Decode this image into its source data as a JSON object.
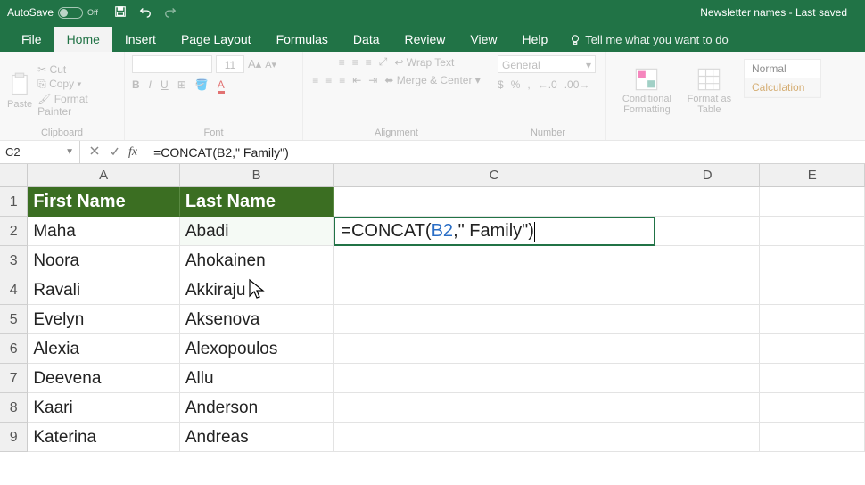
{
  "titlebar": {
    "autosave_label": "AutoSave",
    "autosave_state": "Off",
    "doc_title": "Newsletter names  -  Last saved"
  },
  "tabs": [
    "File",
    "Home",
    "Insert",
    "Page Layout",
    "Formulas",
    "Data",
    "Review",
    "View",
    "Help"
  ],
  "active_tab": "Home",
  "tellme_placeholder": "Tell me what you want to do",
  "ribbon": {
    "clipboard": {
      "paste": "Paste",
      "cut": "Cut",
      "copy": "Copy",
      "painter": "Format Painter",
      "label": "Clipboard"
    },
    "font": {
      "size": "11",
      "label": "Font",
      "bold": "B",
      "italic": "I",
      "underline": "U"
    },
    "alignment": {
      "wrap": "Wrap Text",
      "merge": "Merge & Center",
      "label": "Alignment"
    },
    "number": {
      "format": "General",
      "label": "Number",
      "currency": "$",
      "percent": "%",
      "decinc": ".0",
      "decdec": ".00"
    },
    "styles": {
      "cond": "Conditional Formatting",
      "fmt": "Format as Table",
      "normal": "Normal",
      "calc": "Calculation"
    }
  },
  "namebox": "C2",
  "formula": "=CONCAT(B2,\" Family\")",
  "columns": [
    "A",
    "B",
    "C",
    "D",
    "E"
  ],
  "rows": [
    {
      "n": 1,
      "A": "First Name",
      "B": "Last Name",
      "C": "",
      "header": true
    },
    {
      "n": 2,
      "A": "Maha",
      "B": "Abadi",
      "C_editing": true
    },
    {
      "n": 3,
      "A": "Noora",
      "B": "Ahokainen"
    },
    {
      "n": 4,
      "A": "Ravali",
      "B": "Akkiraju"
    },
    {
      "n": 5,
      "A": "Evelyn",
      "B": "Aksenova"
    },
    {
      "n": 6,
      "A": "Alexia",
      "B": "Alexopoulos"
    },
    {
      "n": 7,
      "A": "Deevena",
      "B": "Allu"
    },
    {
      "n": 8,
      "A": "Kaari",
      "B": "Anderson"
    },
    {
      "n": 9,
      "A": "Katerina",
      "B": "Andreas"
    }
  ],
  "formula_parts": {
    "eq": "=",
    "fn": "CONCAT(",
    "ref": "B2",
    "rest": ",\" Family\")"
  }
}
